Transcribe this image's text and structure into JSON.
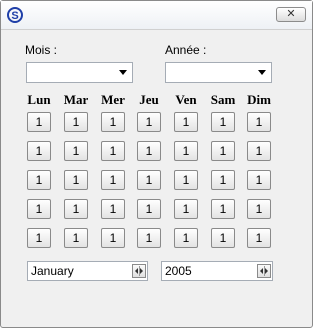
{
  "window": {
    "close_label": "✕",
    "icon": "app-logo-icon"
  },
  "labels": {
    "month": "Mois :",
    "year": "Année :"
  },
  "days": [
    "Lun",
    "Mar",
    "Mer",
    "Jeu",
    "Ven",
    "Sam",
    "Dim"
  ],
  "grid": [
    [
      "1",
      "1",
      "1",
      "1",
      "1",
      "1",
      "1"
    ],
    [
      "1",
      "1",
      "1",
      "1",
      "1",
      "1",
      "1"
    ],
    [
      "1",
      "1",
      "1",
      "1",
      "1",
      "1",
      "1"
    ],
    [
      "1",
      "1",
      "1",
      "1",
      "1",
      "1",
      "1"
    ],
    [
      "1",
      "1",
      "1",
      "1",
      "1",
      "1",
      "1"
    ]
  ],
  "month_spin": {
    "value": "January"
  },
  "year_spin": {
    "value": "2005"
  }
}
